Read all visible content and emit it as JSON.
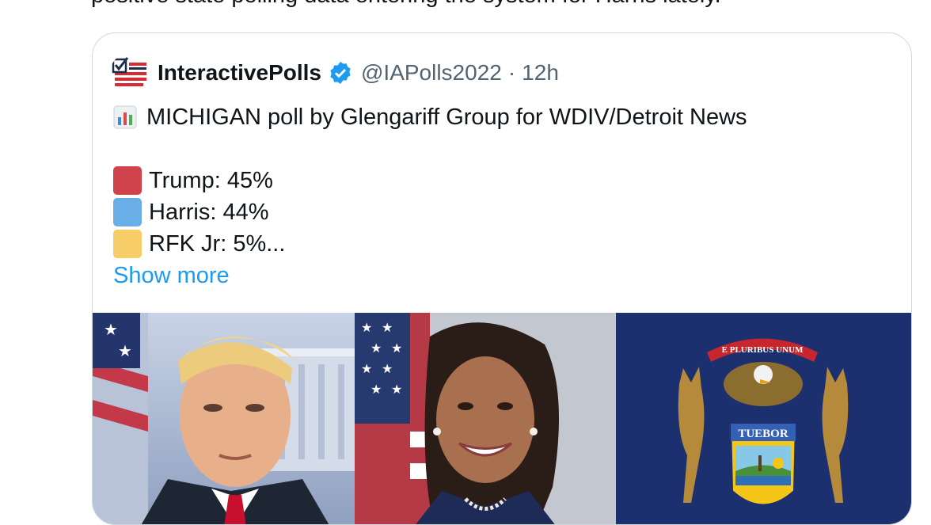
{
  "tweet": {
    "top_text": "positive state polling data entering the system for Harris lately."
  },
  "quote": {
    "display_name": "InteractivePolls",
    "handle": "@IAPolls2022",
    "separator": "·",
    "time": "12h",
    "headline": "MICHIGAN poll by Glengariff Group for WDIV/Detroit News",
    "results": [
      {
        "label": "Trump: 45%",
        "color": "#d0434c"
      },
      {
        "label": "Harris: 44%",
        "color": "#6aaee8"
      },
      {
        "label": "RFK Jr: 5%...",
        "color": "#f7cd6a"
      }
    ],
    "show_more": "Show more",
    "verified_color": "#1d9bf0",
    "media": {
      "flag_motto": "E PLURIBUS UNUM",
      "flag_shield_text": "TUEBOR"
    }
  }
}
